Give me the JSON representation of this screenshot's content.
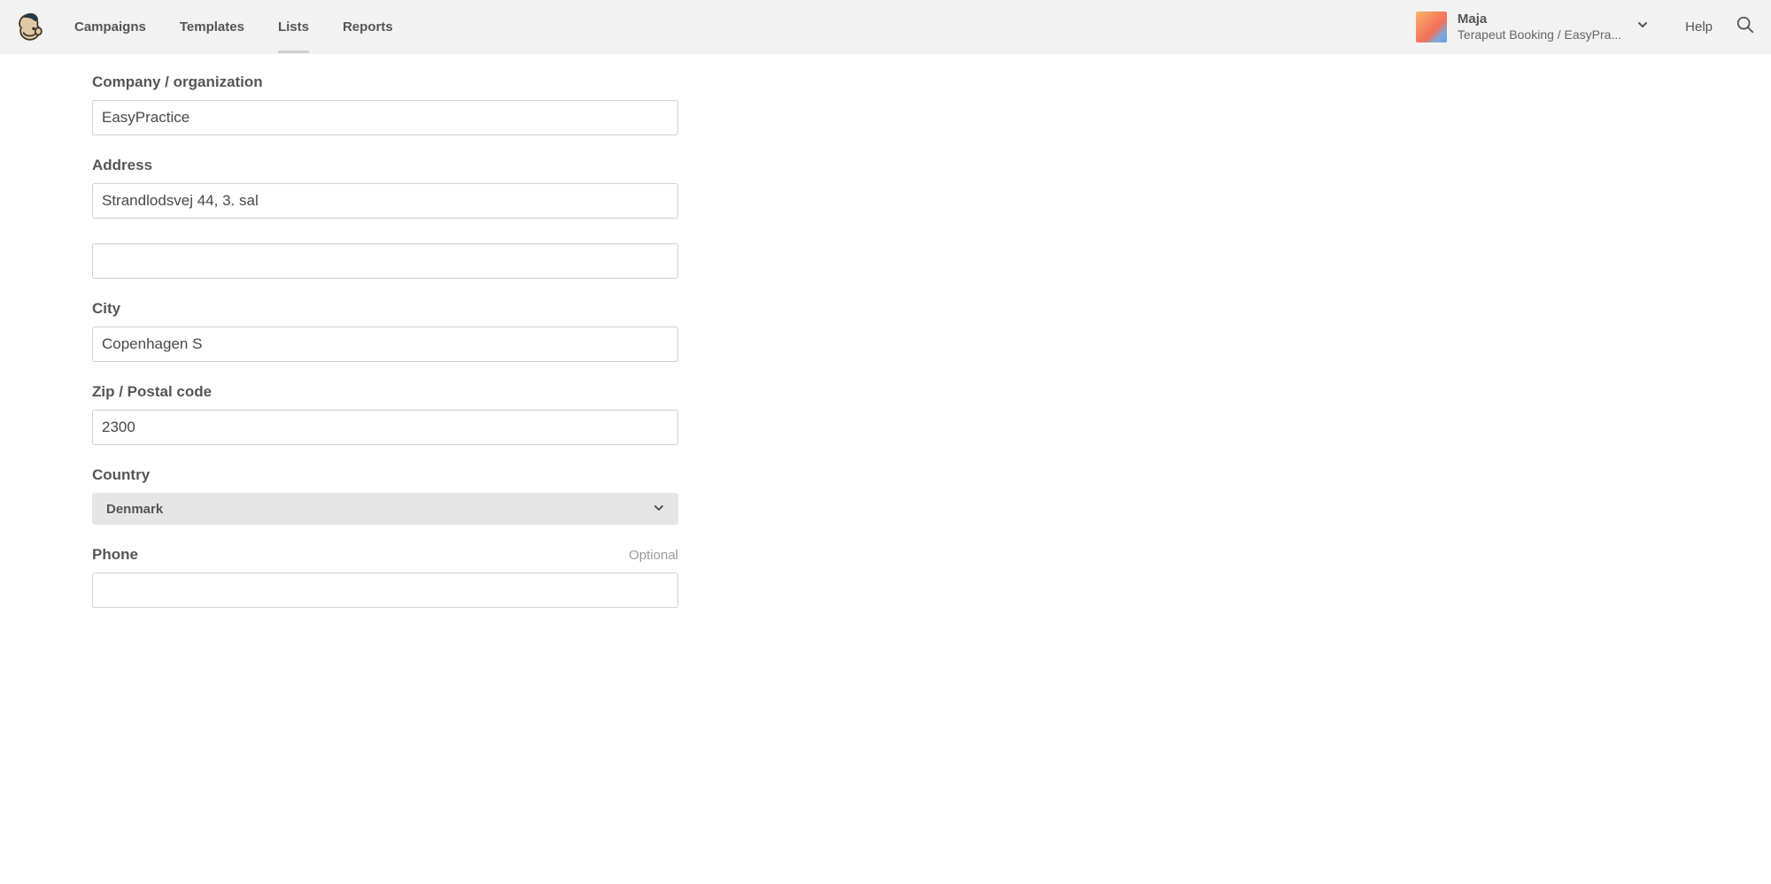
{
  "nav": {
    "items": [
      {
        "label": "Campaigns",
        "active": false
      },
      {
        "label": "Templates",
        "active": false
      },
      {
        "label": "Lists",
        "active": true
      },
      {
        "label": "Reports",
        "active": false
      }
    ]
  },
  "account": {
    "name": "Maja",
    "org": "Terapeut Booking / EasyPra..."
  },
  "help_label": "Help",
  "form": {
    "company_label": "Company / organization",
    "company_value": "EasyPractice",
    "address_label": "Address",
    "address_value": "Strandlodsvej 44, 3. sal",
    "address2_value": "",
    "city_label": "City",
    "city_value": "Copenhagen S",
    "zip_label": "Zip / Postal code",
    "zip_value": "2300",
    "country_label": "Country",
    "country_value": "Denmark",
    "phone_label": "Phone",
    "phone_hint": "Optional",
    "phone_value": ""
  }
}
